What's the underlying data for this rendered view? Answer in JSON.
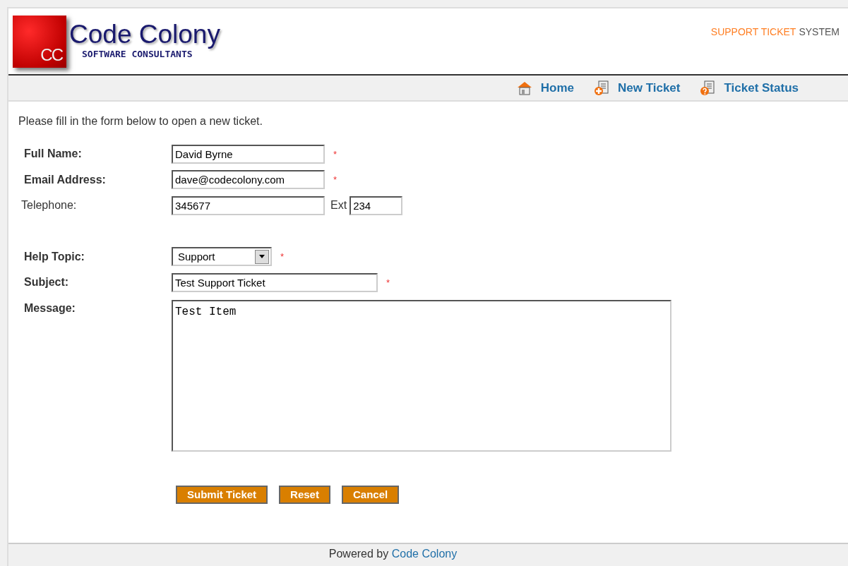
{
  "header": {
    "logo": {
      "badge": "CC",
      "name": "Code Colony",
      "tagline": "SOFTWARE CONSULTANTS"
    },
    "system_title": [
      {
        "text": "SUPPORT TICKET",
        "accent": true
      },
      {
        "text": "SYSTEM",
        "accent": false
      }
    ]
  },
  "nav": [
    {
      "label": "Home",
      "kind": "home"
    },
    {
      "label": "New Ticket",
      "kind": "new"
    },
    {
      "label": "Ticket Status",
      "kind": "status"
    }
  ],
  "intro": "Please fill in the form below to open a new ticket.",
  "fields": [
    {
      "kind": "text",
      "label": "Full Name:",
      "value": "David Byrne",
      "required": true,
      "mark": "*"
    },
    {
      "kind": "text",
      "label": "Email Address:",
      "value": "dave@codecolony.com",
      "required": true,
      "mark": "*"
    },
    {
      "kind": "phone",
      "label": "Telephone:",
      "value": "345677",
      "required": false,
      "ext_label": "Ext",
      "ext_value": "234"
    },
    {
      "kind": "select",
      "label": "Help Topic:",
      "value": "Support",
      "required": true,
      "mark": "*"
    },
    {
      "kind": "wide",
      "label": "Subject:",
      "value": "Test Support Ticket",
      "required": true,
      "mark": "*"
    },
    {
      "kind": "textarea",
      "label": "Message:",
      "value": "Test Item",
      "required": true
    }
  ],
  "buttons": [
    "Submit Ticket",
    "Reset",
    "Cancel"
  ],
  "footer": {
    "text": "Powered by",
    "link": "Code Colony"
  }
}
